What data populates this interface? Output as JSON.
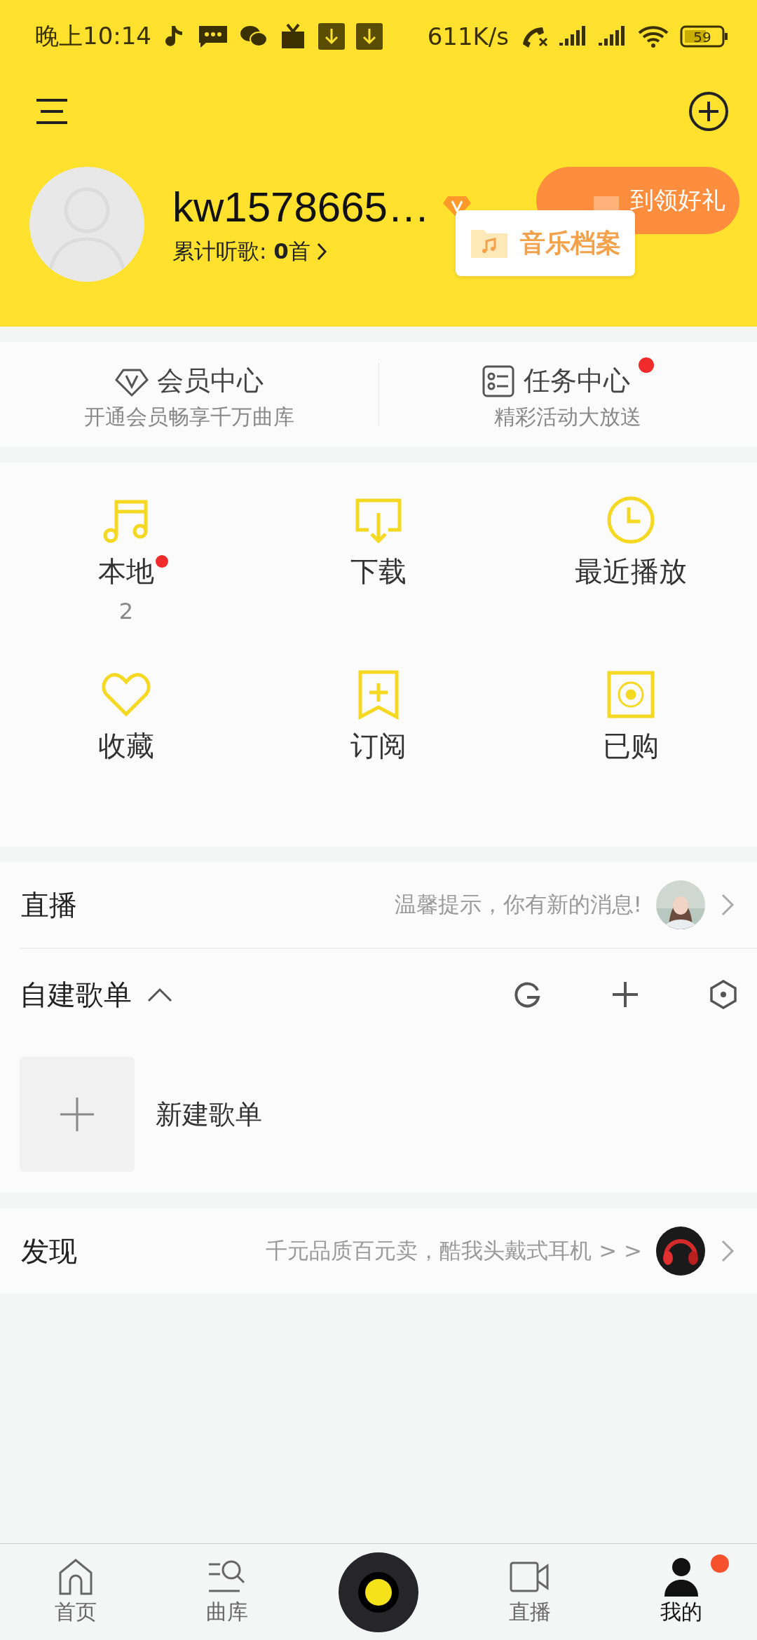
{
  "status_bar": {
    "time": "晚上10:14",
    "speed": "611K/s",
    "battery": "59"
  },
  "profile": {
    "username": "kw1578665…",
    "listen_label": "累计听歌: ",
    "listen_count": "0",
    "listen_unit": "首",
    "checkin_button": "到领好礼",
    "popover": "音乐档案"
  },
  "member_cards": [
    {
      "kind": "vip",
      "title": "会员中心",
      "subtitle": "开通会员畅享千万曲库",
      "badge": false
    },
    {
      "kind": "task",
      "title": "任务中心",
      "subtitle": "精彩活动大放送",
      "badge": true
    }
  ],
  "shortcuts": [
    {
      "kind": "local",
      "label": "本地",
      "count": "2",
      "badge": true
    },
    {
      "kind": "download",
      "label": "下载",
      "badge": false
    },
    {
      "kind": "recent",
      "label": "最近播放",
      "badge": false
    },
    {
      "kind": "favorite",
      "label": "收藏",
      "badge": false
    },
    {
      "kind": "subscribe",
      "label": "订阅",
      "badge": false
    },
    {
      "kind": "purchased",
      "label": "已购",
      "badge": false
    }
  ],
  "live_row": {
    "title": "直播",
    "hint": "温馨提示，你有新的消息!"
  },
  "playlists": {
    "title": "自建歌单",
    "expanded": true,
    "new_label": "新建歌单"
  },
  "discover_row": {
    "title": "发现",
    "hint": "千元品质百元卖，酷我头戴式耳机 > >"
  },
  "tabs": [
    {
      "kind": "home",
      "label": "首页",
      "selected": false,
      "badge": false
    },
    {
      "kind": "library",
      "label": "曲库",
      "selected": false,
      "badge": false
    },
    {
      "kind": "live",
      "label": "直播",
      "selected": false,
      "badge": false
    },
    {
      "kind": "mine",
      "label": "我的",
      "selected": true,
      "badge": true
    }
  ]
}
